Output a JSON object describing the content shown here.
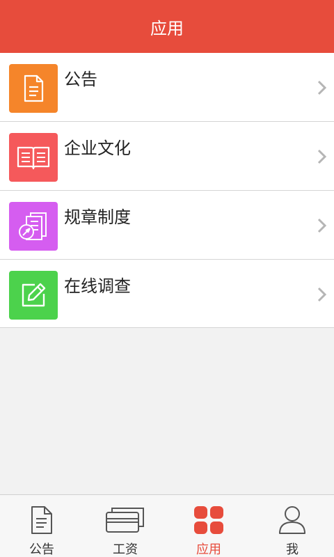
{
  "header": {
    "title": "应用"
  },
  "colors": {
    "brand": "#e74c3c",
    "notice_icon_bg": "#f5852a",
    "culture_icon_bg": "#f5595b",
    "rules_icon_bg": "#d55df0",
    "survey_icon_bg": "#4cd24c"
  },
  "list": {
    "items": [
      {
        "label": "公告",
        "icon": "document-icon"
      },
      {
        "label": "企业文化",
        "icon": "book-icon"
      },
      {
        "label": "规章制度",
        "icon": "rules-icon"
      },
      {
        "label": "在线调查",
        "icon": "edit-icon"
      }
    ]
  },
  "tabbar": {
    "tabs": [
      {
        "label": "公告",
        "icon": "document-icon"
      },
      {
        "label": "工资",
        "icon": "card-icon"
      },
      {
        "label": "应用",
        "icon": "grid-icon",
        "active": true
      },
      {
        "label": "我",
        "icon": "person-icon"
      }
    ]
  }
}
